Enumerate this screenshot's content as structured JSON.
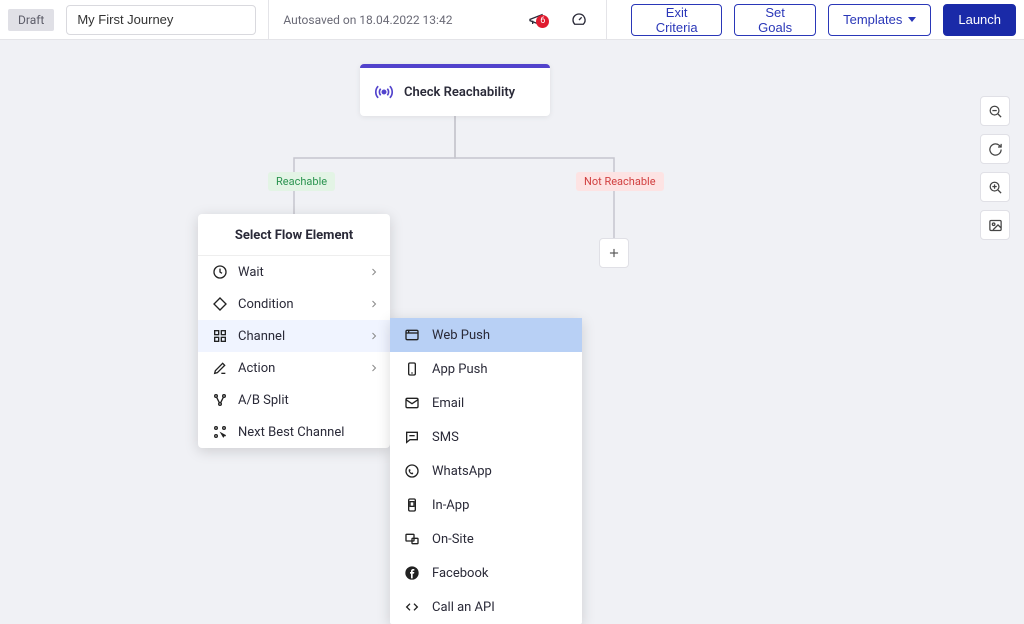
{
  "topbar": {
    "draft_badge": "Draft",
    "journey_title": "My First Journey",
    "autosave_text": "Autosaved on 18.04.2022 13:42",
    "notification_count": "6",
    "exit_criteria_label": "Exit Criteria",
    "set_goals_label": "Set Goals",
    "templates_label": "Templates",
    "launch_label": "Launch"
  },
  "node": {
    "title": "Check Reachability"
  },
  "branches": {
    "reachable": "Reachable",
    "not_reachable": "Not Reachable"
  },
  "menu": {
    "header": "Select Flow Element",
    "items": [
      {
        "label": "Wait",
        "has_sub": true
      },
      {
        "label": "Condition",
        "has_sub": true
      },
      {
        "label": "Channel",
        "has_sub": true
      },
      {
        "label": "Action",
        "has_sub": true
      },
      {
        "label": "A/B Split",
        "has_sub": false
      },
      {
        "label": "Next Best Channel",
        "has_sub": false
      }
    ]
  },
  "submenu": {
    "items": [
      {
        "label": "Web Push"
      },
      {
        "label": "App Push"
      },
      {
        "label": "Email"
      },
      {
        "label": "SMS"
      },
      {
        "label": "WhatsApp"
      },
      {
        "label": "In-App"
      },
      {
        "label": "On-Site"
      },
      {
        "label": "Facebook"
      },
      {
        "label": "Call an API"
      }
    ]
  }
}
